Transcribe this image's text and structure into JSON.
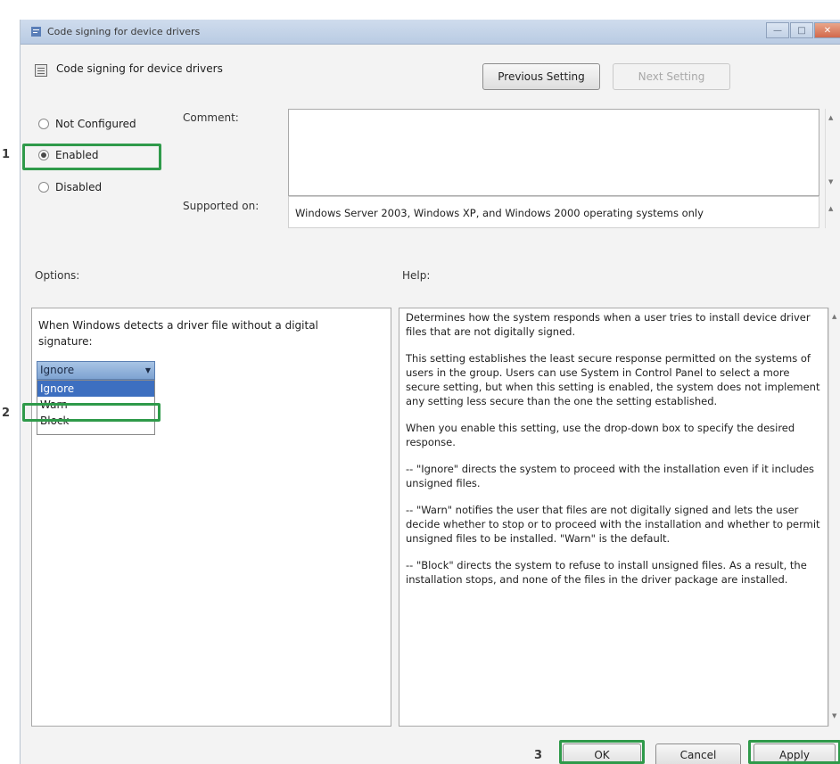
{
  "window": {
    "title": "Code signing for device drivers",
    "controls": [
      "minimize",
      "maximize",
      "close"
    ]
  },
  "header": {
    "title": "Code signing for device drivers",
    "prev_button": "Previous Setting",
    "next_button": "Next Setting"
  },
  "state": {
    "not_configured": "Not Configured",
    "enabled": "Enabled",
    "disabled": "Disabled",
    "selected": "Enabled"
  },
  "comment": {
    "label": "Comment:",
    "value": ""
  },
  "supported": {
    "label": "Supported on:",
    "value": "Windows Server 2003, Windows XP, and Windows 2000 operating systems only"
  },
  "options": {
    "label": "Options:",
    "text": "When Windows detects a driver file without a digital signature:",
    "select_value": "Ignore",
    "items": [
      "Ignore",
      "Warn",
      "Block"
    ],
    "highlighted": "Ignore"
  },
  "help": {
    "label": "Help:",
    "paragraphs": [
      "Determines how the system responds when a user tries to install device driver files that are not digitally signed.",
      "This setting establishes the least secure response permitted on the systems of users in the group. Users can use System in Control Panel to select a more secure setting, but when this setting is enabled, the system does not implement any setting less secure than the one the setting established.",
      "When you enable this setting, use the drop-down box to specify the desired response.",
      "-- \"Ignore\" directs the system to proceed with the installation even if it includes unsigned files.",
      "-- \"Warn\" notifies the user that files are not digitally signed and lets the user decide whether to stop or to proceed with the installation and whether to permit unsigned files to be installed. \"Warn\" is the default.",
      "-- \"Block\" directs the system to refuse to install unsigned files. As a result, the installation stops, and none of the files in the driver package are installed."
    ]
  },
  "footer": {
    "ok": "OK",
    "cancel": "Cancel",
    "apply": "Apply"
  },
  "steps": {
    "one": "1",
    "two": "2",
    "three": "3"
  },
  "colors": {
    "highlight": "#2f9a4a",
    "selection": "#3d6fc0"
  }
}
